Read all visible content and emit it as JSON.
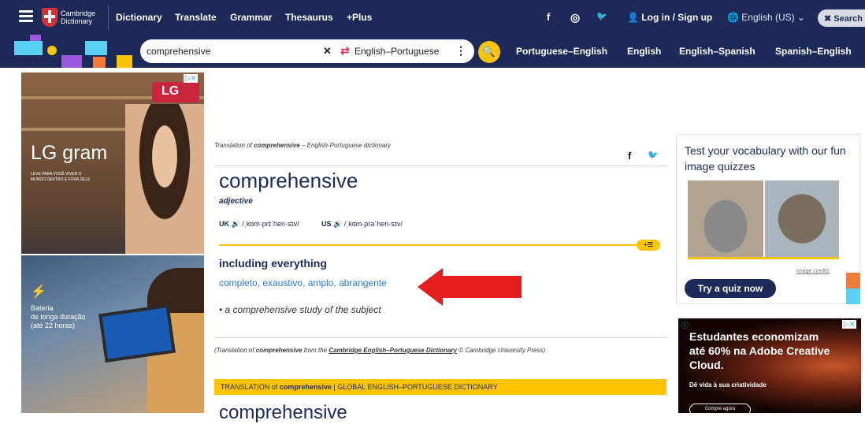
{
  "header": {
    "logo_line1": "Cambridge",
    "logo_line2": "Dictionary",
    "nav": [
      "Dictionary",
      "Translate",
      "Grammar",
      "Thesaurus",
      "+Plus"
    ],
    "social": {
      "facebook": "f",
      "instagram": "◎",
      "twitter": "🐦"
    },
    "login": "Log in / Sign up",
    "language": "English (US)",
    "search_button": "Search"
  },
  "search": {
    "query": "comprehensive",
    "dictionary": "English–Portuguese",
    "quick_links": [
      "Portuguese–English",
      "English",
      "English–Spanish",
      "Spanish–English"
    ]
  },
  "ad_left": {
    "brand": "LG",
    "product": "LG gram",
    "tagline": "LEVE PARA VOCÊ VIVER O MUNDO DENTRO E FORA DELE",
    "battery_line1": "Bateria",
    "battery_line2": "de longa duração",
    "battery_line3": "(até 22 horas)"
  },
  "entry": {
    "breadcrumb_prefix": "Translation of",
    "breadcrumb_word": "comprehensive",
    "breadcrumb_suffix": "– English-Portuguese dictionary",
    "headword": "comprehensive",
    "pos": "adjective",
    "uk_label": "UK",
    "uk_ipa": "/ˌkɒm·prɪˈhen·sɪv/",
    "us_label": "US",
    "us_ipa": "/ˌkɑm·prəˈhen·sɪv/",
    "definition": "including everything",
    "translation": "completo, exaustivo, amplo, abrangente",
    "example": "• a comprehensive study of the subject",
    "credit_prefix": "(Translation of",
    "credit_word": "comprehensive",
    "credit_mid": "from the",
    "credit_dict": "Cambridge English–Portuguese Dictionary",
    "credit_suffix": "© Cambridge University Press)",
    "band_prefix": "TRANSLATION of",
    "band_word": "comprehensive",
    "band_suffix": "| GLOBAL ENGLISH–PORTUGUESE DICTIONARY",
    "next_headword": "comprehensive"
  },
  "quiz": {
    "title": "Test your vocabulary with our fun image quizzes",
    "image_credits": "Image credits",
    "button": "Try a quiz now"
  },
  "ad_right": {
    "headline": "Estudantes economizam até 60% na Adobe Creative Cloud.",
    "sub": "Dê vida à sua criatividade",
    "button": "Compre agora"
  },
  "colors": {
    "navy": "#1d2a57",
    "yellow": "#fec400",
    "link_blue": "#2a7bd8",
    "arrow_red": "#e41e1e"
  }
}
